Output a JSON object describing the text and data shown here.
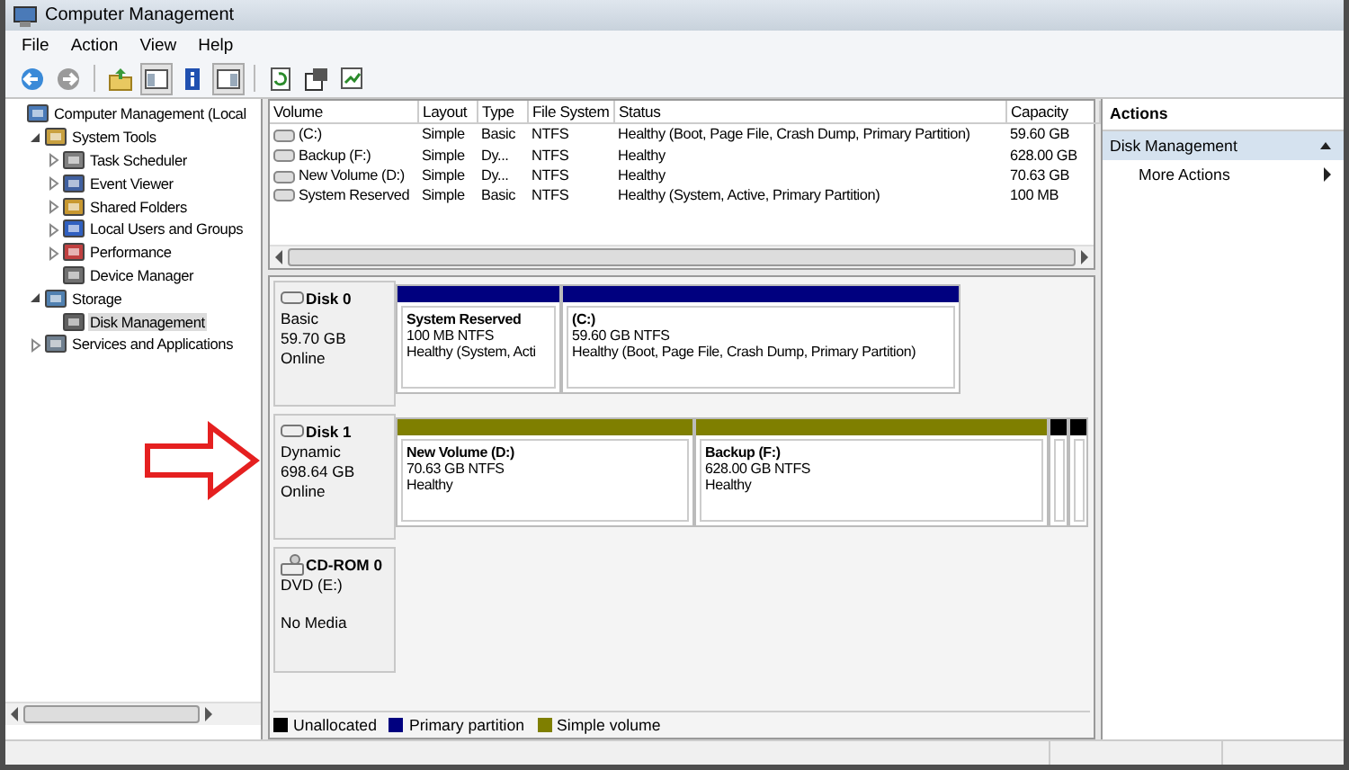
{
  "window": {
    "title": "Computer Management"
  },
  "menu": [
    "File",
    "Action",
    "View",
    "Help"
  ],
  "tree": [
    {
      "label": "Computer Management (Local",
      "selected": false,
      "children": [
        {
          "label": "System Tools",
          "expanded": true,
          "selected": false,
          "children": [
            {
              "label": "Task Scheduler",
              "expanded": false,
              "selected": false
            },
            {
              "label": "Event Viewer",
              "expanded": false,
              "selected": false
            },
            {
              "label": "Shared Folders",
              "expanded": false,
              "selected": false
            },
            {
              "label": "Local Users and Groups",
              "expanded": false,
              "selected": false
            },
            {
              "label": "Performance",
              "expanded": false,
              "selected": false
            },
            {
              "label": "Device Manager",
              "selected": false
            }
          ]
        },
        {
          "label": "Storage",
          "expanded": true,
          "selected": false,
          "children": [
            {
              "label": "Disk Management",
              "selected": true
            }
          ]
        },
        {
          "label": "Services and Applications",
          "expanded": false,
          "selected": false
        }
      ]
    }
  ],
  "volume_table": {
    "columns": [
      "Volume",
      "Layout",
      "Type",
      "File System",
      "Status",
      "Capacity"
    ],
    "rows": [
      [
        "(C:)",
        "Simple",
        "Basic",
        "NTFS",
        "Healthy (Boot, Page File, Crash Dump, Primary Partition)",
        "59.60 GB"
      ],
      [
        "Backup (F:)",
        "Simple",
        "Dy...",
        "NTFS",
        "Healthy",
        "628.00 GB"
      ],
      [
        "New Volume (D:)",
        "Simple",
        "Dy...",
        "NTFS",
        "Healthy",
        "70.63 GB"
      ],
      [
        "System Reserved",
        "Simple",
        "Basic",
        "NTFS",
        "Healthy (System, Active, Primary Partition)",
        "100 MB"
      ]
    ]
  },
  "disks": [
    {
      "kind": "disk",
      "name": "Disk 0",
      "lines": [
        "Basic",
        "59.70 GB",
        "Online"
      ],
      "partitions": [
        {
          "color": "#00007f",
          "name": "System Reserved",
          "size": "100 MB NTFS",
          "status": "Healthy (System, Acti"
        },
        {
          "color": "#00007f",
          "name": "(C:)",
          "size": "59.60 GB NTFS",
          "status": "Healthy (Boot, Page File, Crash Dump, Primary Partition)"
        }
      ]
    },
    {
      "kind": "disk",
      "name": "Disk 1",
      "lines": [
        "Dynamic",
        "698.64 GB",
        "Online"
      ],
      "partitions": [
        {
          "color": "#7f7f00",
          "name": "New Volume  (D:)",
          "size": "70.63 GB NTFS",
          "status": "Healthy"
        },
        {
          "color": "#7f7f00",
          "name": "Backup  (F:)",
          "size": "628.00 GB NTFS",
          "status": "Healthy"
        },
        {
          "color": "#000000"
        },
        {
          "color": "#000000"
        }
      ]
    },
    {
      "kind": "cdrom",
      "name": "CD-ROM 0",
      "lines": [
        "DVD (E:)",
        "No Media"
      ]
    }
  ],
  "legend": [
    {
      "label": "Unallocated",
      "color": "#000000"
    },
    {
      "label": "Primary partition",
      "color": "#00007f"
    },
    {
      "label": "Simple volume",
      "color": "#7f7f00"
    }
  ],
  "actions": {
    "title": "Actions",
    "section": "Disk Management",
    "expanded": true,
    "items": [
      "More Actions"
    ]
  }
}
